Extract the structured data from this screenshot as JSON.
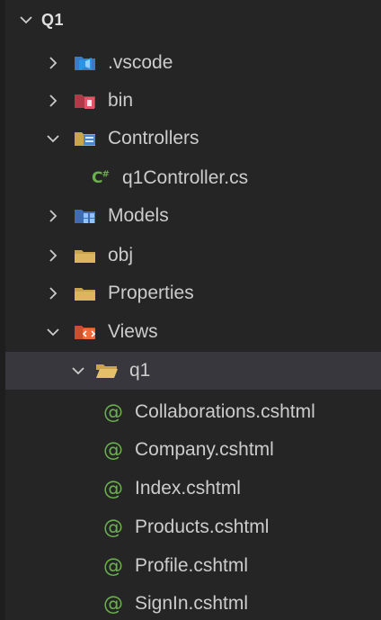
{
  "explorer": {
    "root": {
      "label": "Q1",
      "expanded": true
    },
    "items": [
      {
        "label": ".vscode",
        "kind": "folder",
        "icon": "vscode-folder-icon",
        "expanded": false
      },
      {
        "label": "bin",
        "kind": "folder",
        "icon": "bin-folder-icon",
        "expanded": false
      },
      {
        "label": "Controllers",
        "kind": "folder",
        "icon": "controllers-folder-icon",
        "expanded": true
      },
      {
        "label": "q1Controller.cs",
        "kind": "file",
        "icon": "csharp-icon",
        "icon_text": "C#"
      },
      {
        "label": "Models",
        "kind": "folder",
        "icon": "models-folder-icon",
        "expanded": false
      },
      {
        "label": "obj",
        "kind": "folder",
        "icon": "folder-icon",
        "expanded": false
      },
      {
        "label": "Properties",
        "kind": "folder",
        "icon": "folder-icon",
        "expanded": false
      },
      {
        "label": "Views",
        "kind": "folder",
        "icon": "views-folder-icon",
        "expanded": true
      },
      {
        "label": "q1",
        "kind": "folder",
        "icon": "open-folder-icon",
        "expanded": true,
        "selected": true
      },
      {
        "label": "Collaborations.cshtml",
        "kind": "file",
        "icon": "razor-icon",
        "icon_text": "@"
      },
      {
        "label": "Company.cshtml",
        "kind": "file",
        "icon": "razor-icon",
        "icon_text": "@"
      },
      {
        "label": "Index.cshtml",
        "kind": "file",
        "icon": "razor-icon",
        "icon_text": "@"
      },
      {
        "label": "Products.cshtml",
        "kind": "file",
        "icon": "razor-icon",
        "icon_text": "@"
      },
      {
        "label": "Profile.cshtml",
        "kind": "file",
        "icon": "razor-icon",
        "icon_text": "@"
      },
      {
        "label": "SignIn.cshtml",
        "kind": "file",
        "icon": "razor-icon",
        "icon_text": "@"
      }
    ]
  },
  "colors": {
    "background": "#252526",
    "selected_row": "#37373d",
    "text": "#cccccc",
    "razor_icon": "#6ab04c",
    "folder_icon": "#c9a34e"
  }
}
